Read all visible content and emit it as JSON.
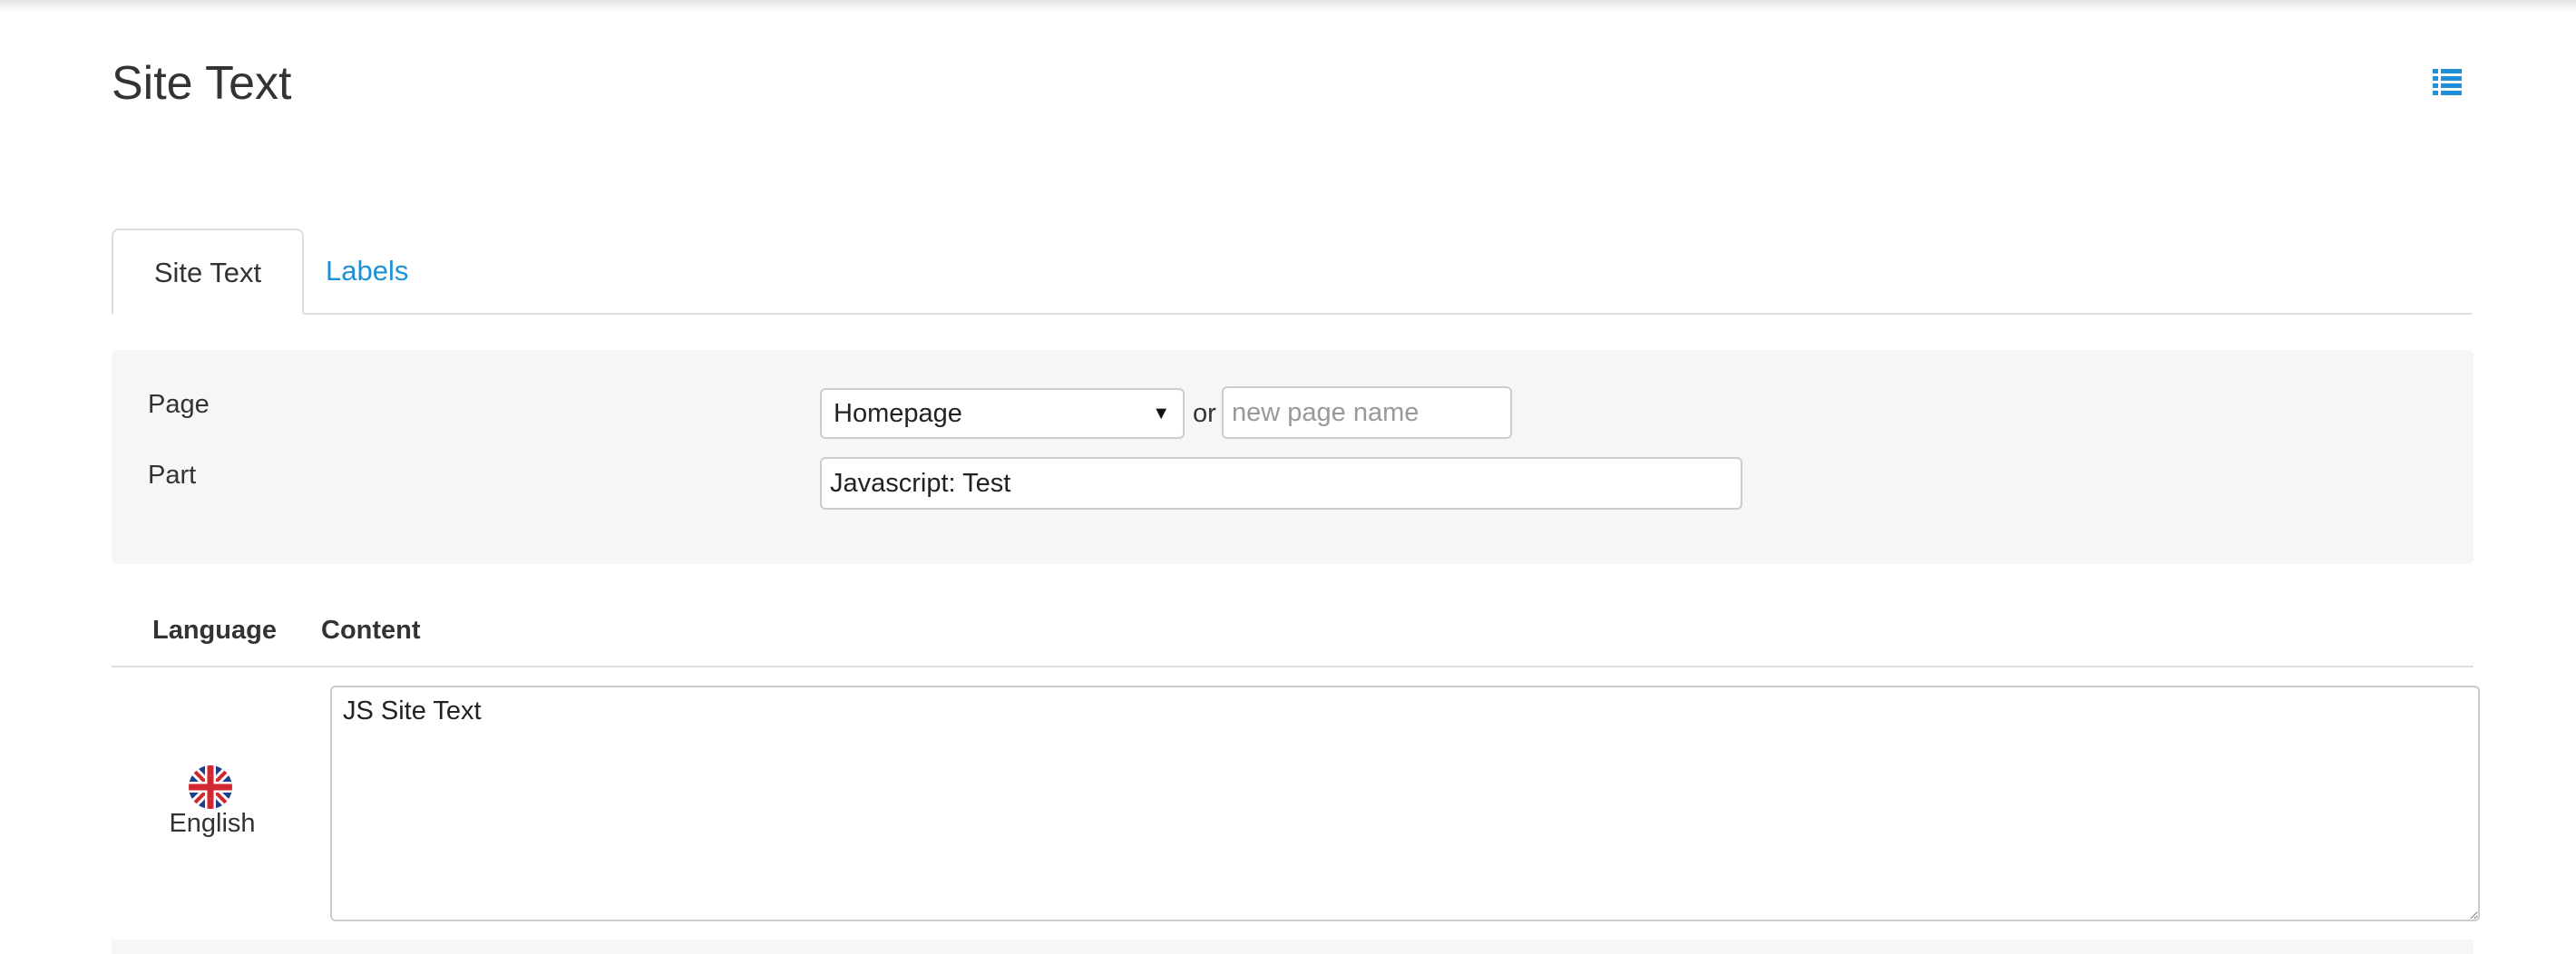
{
  "header": {
    "title": "Site Text",
    "list_icon": "list-icon",
    "accent_color": "#1e90d6"
  },
  "tabs": [
    {
      "label": "Site Text",
      "active": true
    },
    {
      "label": "Labels",
      "active": false
    }
  ],
  "form": {
    "page_label": "Page",
    "page_select_value": "Homepage",
    "or_text": "or",
    "new_page_placeholder": "new page name",
    "new_page_value": "",
    "part_label": "Part",
    "part_value": "Javascript: Test"
  },
  "table": {
    "columns": [
      "Language",
      "Content"
    ],
    "rows": [
      {
        "flag_icon": "uk-flag-icon",
        "language": "English",
        "content": "JS Site Text"
      }
    ]
  }
}
